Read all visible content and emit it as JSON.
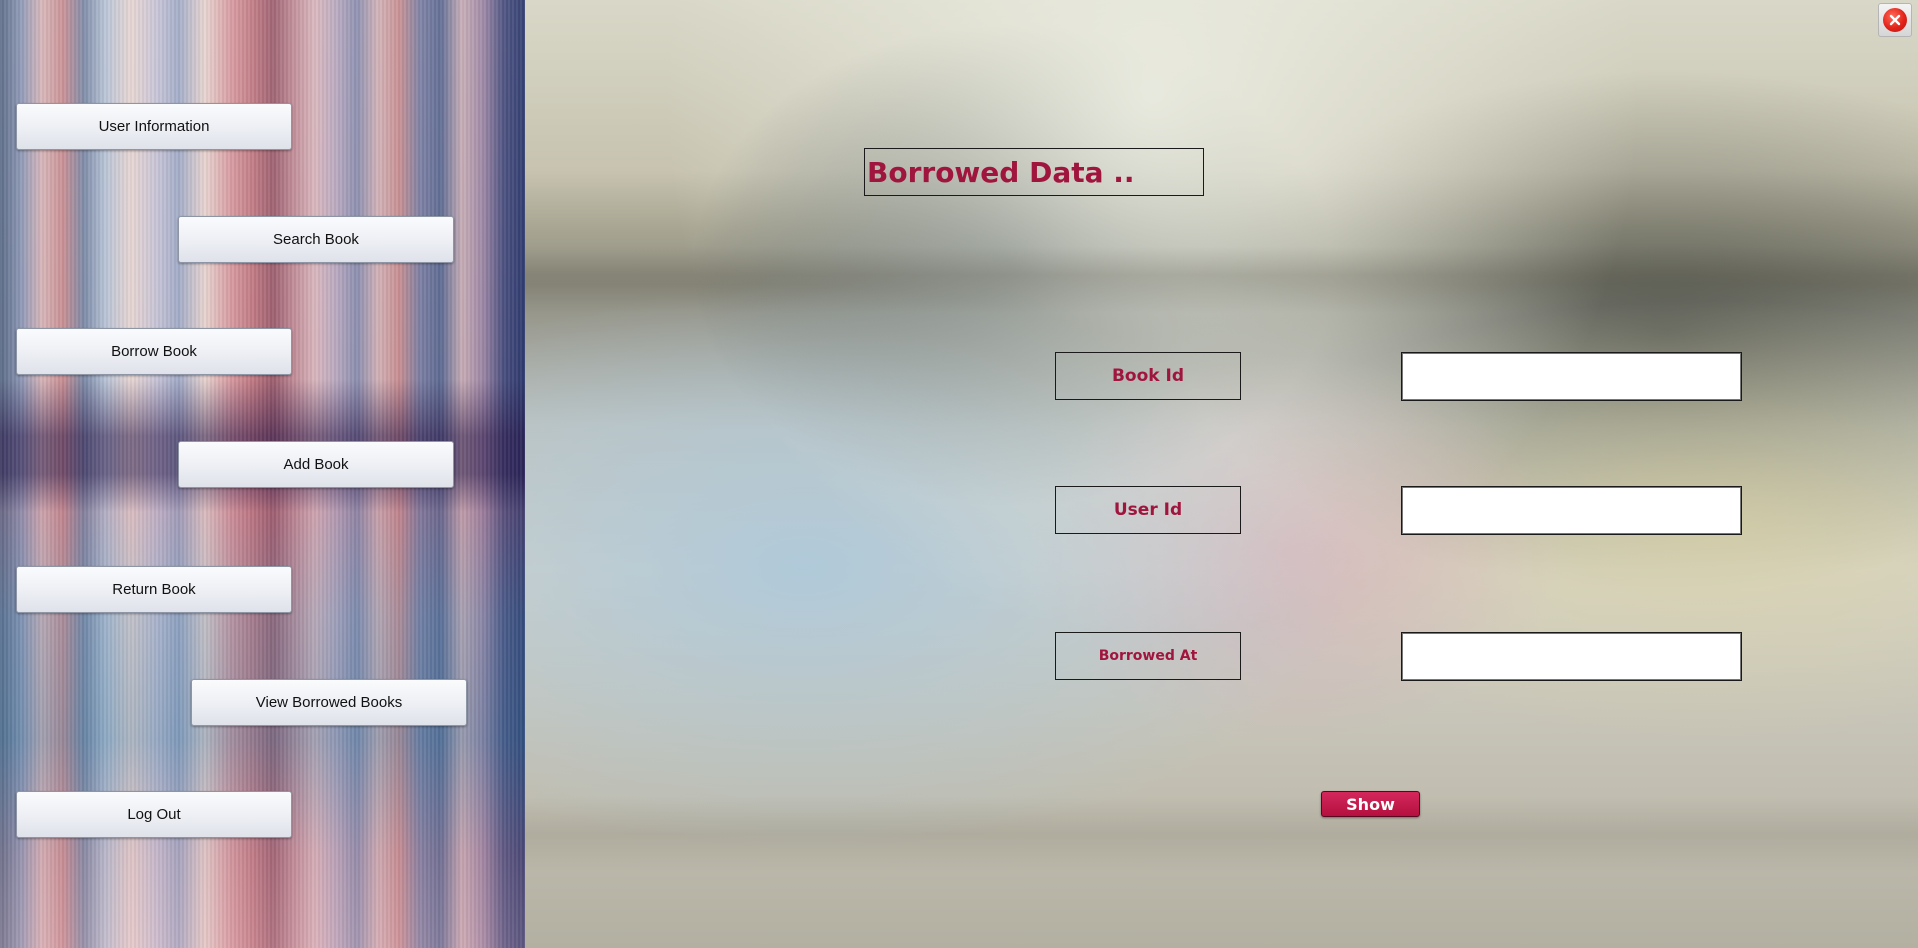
{
  "sidebar": {
    "items": [
      {
        "label": "User Information"
      },
      {
        "label": "Search Book"
      },
      {
        "label": "Borrow Book"
      },
      {
        "label": "Add Book"
      },
      {
        "label": "Return Book"
      },
      {
        "label": "View Borrowed Books"
      },
      {
        "label": "Log Out"
      }
    ]
  },
  "main": {
    "title": "Borrowed Data ..",
    "fields": [
      {
        "label": "Book Id",
        "value": ""
      },
      {
        "label": "User Id",
        "value": ""
      },
      {
        "label": "Borrowed At",
        "value": ""
      }
    ],
    "show_label": "Show"
  },
  "window": {
    "close_icon": "close-icon"
  },
  "colors": {
    "accent": "#a0153e",
    "show_button": "#c41a4d",
    "close_red": "#e2231a"
  }
}
